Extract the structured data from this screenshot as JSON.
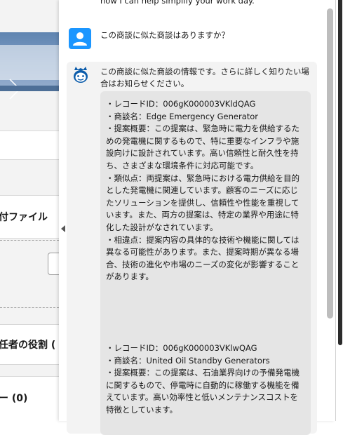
{
  "background_page": {
    "attachment_heading": "付ファイル",
    "role_heading": "任者の役割 (",
    "count_heading": "ー (0)"
  },
  "chat": {
    "top_partial_text": "how I can help simplify your work day.",
    "user_message": "この商談に似た商談はありますか？",
    "bot_intro": "この商談に似た商談の情報です。さらに詳しく知りたい場合はお知らせください。",
    "entries": [
      {
        "record_id": "・レコードID：006gK000003VKldQAG",
        "name": "・商談名：Edge Emergency Generator",
        "summary": "・提案概要：この提案は、緊急時に電力を供給するための発電機に関するもので、特に重要なインフラや施設向けに設計されています。高い信頼性と耐久性を持ち、さまざまな環境条件に対応可能です。",
        "similarity": "・類似点：両提案は、緊急時における電力供給を目的とした発電機に関連しています。顧客のニーズに応じたソリューションを提供し、信頼性や性能を重視しています。また、両方の提案は、特定の業界や用途に特化した設計がなされています。",
        "difference": "・相違点：提案内容の具体的な技術や機能に関しては異なる可能性があります。また、提案時期が異なる場合、技術の進化や市場のニーズの変化が影響することがあります。"
      },
      {
        "record_id": "・レコードID：006gK000003VKlwQAG",
        "name": "・商談名：United Oil Standby Generators",
        "summary": "・提案概要：この提案は、石油業界向けの予備発電機に関するもので、停電時に自動的に稼働する機能を備えています。高い効率性と低いメンテナンスコストを特徴としています。"
      }
    ]
  },
  "colors": {
    "user_avatar": "#1b96ff",
    "bot_avatar": "#0b5cab",
    "card_bg": "#e5e5e5",
    "message_bg": "#f3f3f3"
  },
  "icons": {
    "user_avatar": "user-icon",
    "bot_avatar": "einstein-bot-icon",
    "collapse": "caret-left-icon"
  }
}
